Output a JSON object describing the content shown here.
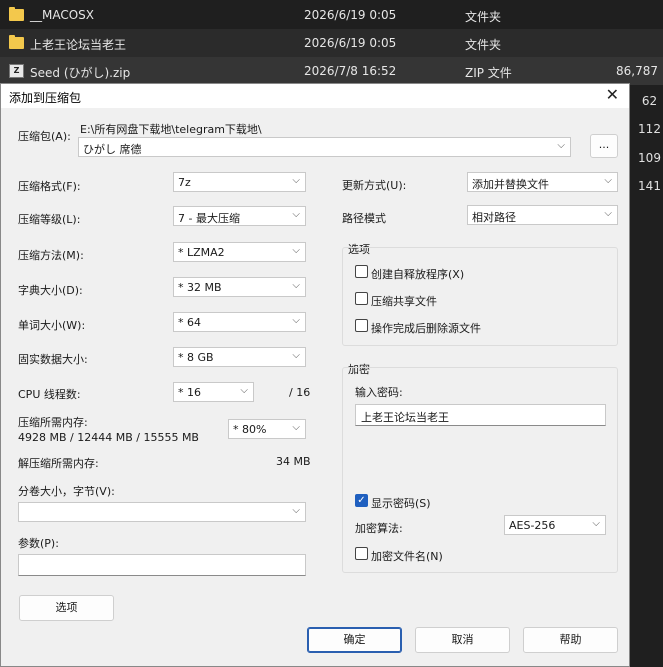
{
  "files": [
    {
      "name": "__MACOSX",
      "date": "2026/6/19 0:05",
      "type": "文件夹",
      "size": ""
    },
    {
      "name": "上老王论坛当老王",
      "date": "2026/6/19 0:05",
      "type": "文件夹",
      "size": ""
    },
    {
      "name": "Seed (ひがし).zip",
      "date": "2026/7/8 16:52",
      "type": "ZIP 文件",
      "size": "86,787"
    }
  ],
  "side_numbers": [
    "62",
    "112",
    "109",
    "141"
  ],
  "dialog": {
    "title": "添加到压缩包",
    "close": "✕",
    "archive_label": "压缩包(A):",
    "archive_path": "E:\\所有网盘下载地\\telegram下载地\\",
    "archive_name": "ひがし 席德",
    "browse": "...",
    "format_label": "压缩格式(F):",
    "format": "7z",
    "level_label": "压缩等级(L):",
    "level": "7 - 最大压缩",
    "method_label": "压缩方法(M):",
    "method": "* LZMA2",
    "dict_label": "字典大小(D):",
    "dict": "* 32 MB",
    "word_label": "单词大小(W):",
    "word": "* 64",
    "solid_label": "固实数据大小:",
    "solid": "* 8 GB",
    "cpu_label": "CPU 线程数:",
    "cpu": "* 16",
    "cpu_max": "/ 16",
    "mem_label": "压缩所需内存:",
    "mem_value": "4928 MB / 12444 MB / 15555 MB",
    "mem_pct": "* 80%",
    "decomp_label": "解压缩所需内存:",
    "decomp_value": "34 MB",
    "split_label": "分卷大小，字节(V):",
    "split_value": "",
    "params_label": "参数(P):",
    "params_value": "",
    "options_button": "选项",
    "update_label": "更新方式(U):",
    "update": "添加并替换文件",
    "path_label": "路径模式",
    "path": "相对路径",
    "options_group": "选项",
    "opt_sfx": "创建自释放程序(X)",
    "opt_shared": "压缩共享文件",
    "opt_delete": "操作完成后删除源文件",
    "encrypt_group": "加密",
    "pw_label": "输入密码:",
    "pw_value": "上老王论坛当老王",
    "show_pw": "显示密码(S)",
    "enc_method_label": "加密算法:",
    "enc_method": "AES-256",
    "enc_names": "加密文件名(N)",
    "ok": "确定",
    "cancel": "取消",
    "help": "帮助"
  }
}
